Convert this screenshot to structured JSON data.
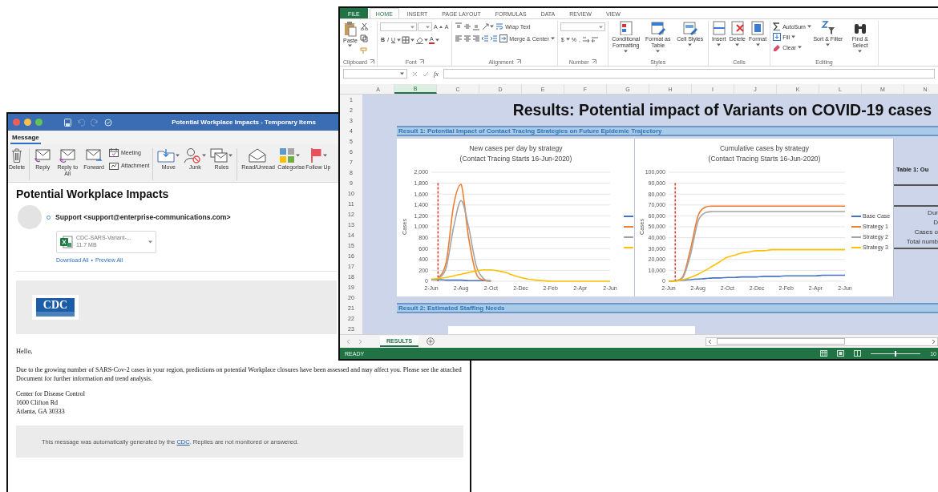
{
  "outlook": {
    "title": "Potential Workplace Impacts - Temporary Items",
    "tabs": [
      {
        "label": "Message",
        "selected": true
      }
    ],
    "ribbon_groups": [
      {
        "items": [
          {
            "label": "Delete",
            "kind": "large",
            "dropdown": false
          }
        ]
      },
      {
        "items": [
          {
            "label": "Reply",
            "kind": "large",
            "dropdown": false
          },
          {
            "label": "Reply to All",
            "kind": "large",
            "dropdown": false
          },
          {
            "label": "Forward",
            "kind": "large",
            "dropdown": false
          },
          {
            "label": "Meeting",
            "kind": "small",
            "dropdown": false
          },
          {
            "label": "Attachment",
            "kind": "small",
            "dropdown": false
          }
        ]
      },
      {
        "items": [
          {
            "label": "Move",
            "kind": "large",
            "dropdown": true
          },
          {
            "label": "Junk",
            "kind": "large",
            "dropdown": true
          },
          {
            "label": "Rules",
            "kind": "large",
            "dropdown": true
          }
        ]
      },
      {
        "items": [
          {
            "label": "Read/Unread",
            "kind": "large",
            "dropdown": false
          },
          {
            "label": "Categorise",
            "kind": "large",
            "dropdown": true
          },
          {
            "label": "Follow Up",
            "kind": "large",
            "dropdown": true
          }
        ]
      }
    ],
    "message": {
      "subject": "Potential Workplace Impacts",
      "sender": "Support <support@enterprise-communications.com>",
      "attachment": {
        "name": "CDC-SARS-Variant-...",
        "size": "11.7 MB"
      },
      "links": [
        "Download All",
        "Preview All"
      ],
      "link_separator": "•",
      "banner": {
        "logo_text": "CDC"
      },
      "greeting": "Hello,",
      "paragraph": "Due to the growing number of SARS-Cov-2 cases in your region, predictions on potential Workplace closures have been assessed and may affect you. Please see the attached Document for further information and trend analysis.",
      "signature": [
        "Center for Disease Control",
        "1600 Clifton Rd",
        "Atlanta, GA 30333"
      ],
      "footer": {
        "before": "This message was automatically generated by the ",
        "link": "CDC",
        "after": ". Replies are not monitored or answered."
      }
    }
  },
  "excel": {
    "tabs": [
      {
        "label": "FILE",
        "kind": "file",
        "selected": false
      },
      {
        "label": "HOME",
        "kind": "tab",
        "selected": true
      },
      {
        "label": "INSERT",
        "kind": "tab",
        "selected": false
      },
      {
        "label": "PAGE LAYOUT",
        "kind": "tab",
        "selected": false
      },
      {
        "label": "FORMULAS",
        "kind": "tab",
        "selected": false
      },
      {
        "label": "DATA",
        "kind": "tab",
        "selected": false
      },
      {
        "label": "REVIEW",
        "kind": "tab",
        "selected": false
      },
      {
        "label": "VIEW",
        "kind": "tab",
        "selected": false
      }
    ],
    "ribbon_groups": [
      {
        "kind": "clipboard",
        "label": "Clipboard",
        "buttons": [
          "Paste"
        ]
      },
      {
        "kind": "font",
        "label": "Font",
        "buttons": [
          "A",
          "A",
          "B",
          "I",
          "U",
          "A"
        ]
      },
      {
        "kind": "alignment",
        "label": "Alignment",
        "buttons": [
          "Wrap Text",
          "Merge & Center"
        ]
      },
      {
        "kind": "number",
        "label": "Number",
        "buttons": [
          "$",
          "%",
          ","
        ]
      },
      {
        "kind": "styles",
        "label": "Styles",
        "buttons": [
          "Conditional Formatting",
          "Format as Table",
          "Cell Styles"
        ]
      },
      {
        "kind": "cells",
        "label": "Cells",
        "buttons": [
          "Insert",
          "Delete",
          "Format"
        ]
      },
      {
        "kind": "editing",
        "label": "Editing",
        "buttons": [
          "AutoSum",
          "Fill",
          "Clear",
          "Sort & Filter",
          "Find & Select"
        ]
      }
    ],
    "formula_bar": {
      "function_label": "fx"
    },
    "columns": [
      {
        "label": "A",
        "selected": false
      },
      {
        "label": "B",
        "selected": true
      },
      {
        "label": "C",
        "selected": false
      },
      {
        "label": "D",
        "selected": false
      },
      {
        "label": "E",
        "selected": false
      },
      {
        "label": "F",
        "selected": false
      },
      {
        "label": "G",
        "selected": false
      },
      {
        "label": "H",
        "selected": false
      },
      {
        "label": "I",
        "selected": false
      },
      {
        "label": "J",
        "selected": false
      },
      {
        "label": "K",
        "selected": false
      },
      {
        "label": "L",
        "selected": false
      },
      {
        "label": "M",
        "selected": false
      },
      {
        "label": "N",
        "selected": false
      }
    ],
    "rows": [
      "1",
      "2",
      "3",
      "4",
      "5",
      "6",
      "7",
      "8",
      "9",
      "10",
      "11",
      "12",
      "13",
      "14",
      "15",
      "16",
      "17",
      "18",
      "19",
      "20",
      "21",
      "22",
      "23"
    ],
    "sheet": {
      "title": "Results: Potential impact of Variants on COVID-19 cases",
      "sections": [
        "Result 1: Potential Impact of Contact Tracing Strategies on Future Epidemic Trajectory",
        "Result 2: Estimated Staffing Needs"
      ],
      "charts": [
        {
          "subtitle": "(Contact Tracing Starts 16-Jun-2020)",
          "chart_data": {
            "type": "line",
            "title": "New cases per day by strategy",
            "ylabel": "Cases",
            "categories": [
              "2-Jun",
              null,
              null,
              null,
              "2-Aug",
              null,
              null,
              null,
              "2-Oct",
              null,
              null,
              null,
              "2-Dec",
              null,
              null,
              null,
              "2-Feb",
              null,
              null,
              null,
              "2-Apr",
              null,
              null,
              null,
              "2-Jun"
            ],
            "series": [
              {
                "color": "#4472c4",
                "values": [
                  30,
                  30,
                  20,
                  20,
                  20,
                  10,
                  10,
                  10,
                  10,
                  null,
                  null,
                  null,
                  null,
                  null,
                  null,
                  null,
                  null,
                  null,
                  null,
                  null,
                  null,
                  null,
                  null,
                  null,
                  null
                ]
              },
              {
                "color": "#ed7d31",
                "values": [
                  null,
                  60,
                  350,
                  1400,
                  1780,
                  800,
                  150,
                  20,
                  0,
                  null,
                  null,
                  null,
                  null,
                  null,
                  null,
                  null,
                  null,
                  null,
                  null,
                  null,
                  null,
                  null,
                  null,
                  null,
                  null
                ]
              },
              {
                "color": "#a5a5a5",
                "values": [
                  null,
                  50,
                  250,
                  1000,
                  1480,
                  1000,
                  300,
                  50,
                  0,
                  null,
                  null,
                  null,
                  null,
                  null,
                  null,
                  null,
                  null,
                  null,
                  null,
                  null,
                  null,
                  null,
                  null,
                  null,
                  null
                ]
              },
              {
                "color": "#ffc000",
                "values": [
                  40,
                  50,
                  70,
                  100,
                  130,
                  160,
                  190,
                  210,
                  210,
                  190,
                  160,
                  110,
                  70,
                  40,
                  20,
                  10,
                  0,
                  0,
                  0,
                  0,
                  0,
                  0,
                  0,
                  0,
                  0
                ]
              }
            ],
            "ylim": [
              0,
              2000
            ],
            "grid": true,
            "legend": "right",
            "yticks": [
              {
                "value": 0,
                "label": "0"
              },
              {
                "value": 200,
                "label": "200"
              },
              {
                "value": 400,
                "label": "400"
              },
              {
                "value": 600,
                "label": "600"
              },
              {
                "value": 800,
                "label": "800"
              },
              {
                "value": 1000,
                "label": "1,000"
              },
              {
                "value": 1200,
                "label": "1,200"
              },
              {
                "value": 1400,
                "label": "1,400"
              },
              {
                "value": 1600,
                "label": "1,600"
              },
              {
                "value": 1800,
                "label": "1,800"
              },
              {
                "value": 2000,
                "label": "2,000"
              }
            ]
          }
        },
        {
          "subtitle": "(Contact Tracing Starts 16-Jun-2020)",
          "chart_data": {
            "type": "line",
            "title": "Cumulative cases by strategy",
            "ylabel": "Cases",
            "categories": [
              "2-Jun",
              null,
              null,
              null,
              "2-Aug",
              null,
              null,
              null,
              "2-Oct",
              null,
              null,
              null,
              "2-Dec",
              null,
              null,
              null,
              "2-Feb",
              null,
              null,
              null,
              "2-Apr",
              null,
              null,
              null,
              "2-Jun"
            ],
            "series": [
              {
                "name": "Base Case",
                "color": "#4472c4",
                "values": [
                  0,
                  500,
                  1000,
                  1500,
                  2000,
                  2500,
                  3000,
                  3000,
                  3500,
                  3500,
                  4000,
                  4000,
                  4000,
                  4500,
                  4500,
                  4500,
                  5000,
                  5000,
                  5000,
                  5000,
                  5000,
                  5500,
                  5500,
                  5500,
                  5500
                ]
              },
              {
                "name": "Strategy 1",
                "color": "#ed7d31",
                "values": [
                  0,
                  500,
                  5000,
                  30000,
                  60000,
                  68000,
                  69000,
                  69000,
                  69000,
                  69000,
                  69000,
                  69000,
                  69000,
                  69000,
                  69000,
                  69000,
                  69000,
                  69000,
                  69000,
                  69000,
                  69000,
                  69000,
                  69000,
                  69000,
                  69000
                ]
              },
              {
                "name": "Strategy 2",
                "color": "#a5a5a5",
                "values": [
                  0,
                  400,
                  4000,
                  25000,
                  55000,
                  63000,
                  64000,
                  64000,
                  64000,
                  64000,
                  64000,
                  64000,
                  64000,
                  64000,
                  64000,
                  64000,
                  64000,
                  64000,
                  64000,
                  64000,
                  64000,
                  64000,
                  64000,
                  64000,
                  64000
                ]
              },
              {
                "name": "Strategy 3",
                "color": "#ffc000",
                "values": [
                  0,
                  200,
                  1500,
                  3500,
                  6500,
                  10000,
                  14000,
                  18000,
                  22000,
                  24000,
                  26000,
                  27000,
                  28000,
                  28000,
                  29000,
                  29000,
                  29000,
                  29000,
                  29000,
                  29000,
                  29000,
                  29000,
                  29000,
                  29000,
                  29000
                ]
              }
            ],
            "ylim": [
              0,
              100000
            ],
            "grid": true,
            "legend": "right",
            "yticks": [
              {
                "value": 0,
                "label": "0"
              },
              {
                "value": 10000,
                "label": "10,000"
              },
              {
                "value": 20000,
                "label": "20,000"
              },
              {
                "value": 30000,
                "label": "30,000"
              },
              {
                "value": 40000,
                "label": "40,000"
              },
              {
                "value": 50000,
                "label": "50,000"
              },
              {
                "value": 60000,
                "label": "60,000"
              },
              {
                "value": 70000,
                "label": "70,000"
              },
              {
                "value": 80000,
                "label": "80,000"
              },
              {
                "value": 90000,
                "label": "90,000"
              },
              {
                "value": 100000,
                "label": "100,000"
              }
            ]
          }
        }
      ],
      "table": {
        "title": "Table 1: Ou",
        "rows": [
          "Dur",
          "D",
          "Cases o",
          "Total numb"
        ]
      }
    },
    "sheet_tabs": [
      {
        "label": "RESULTS",
        "selected": true
      }
    ],
    "status_bar": {
      "text": "READY",
      "zoom": {
        "level": 0.5,
        "reading": "10"
      }
    }
  }
}
